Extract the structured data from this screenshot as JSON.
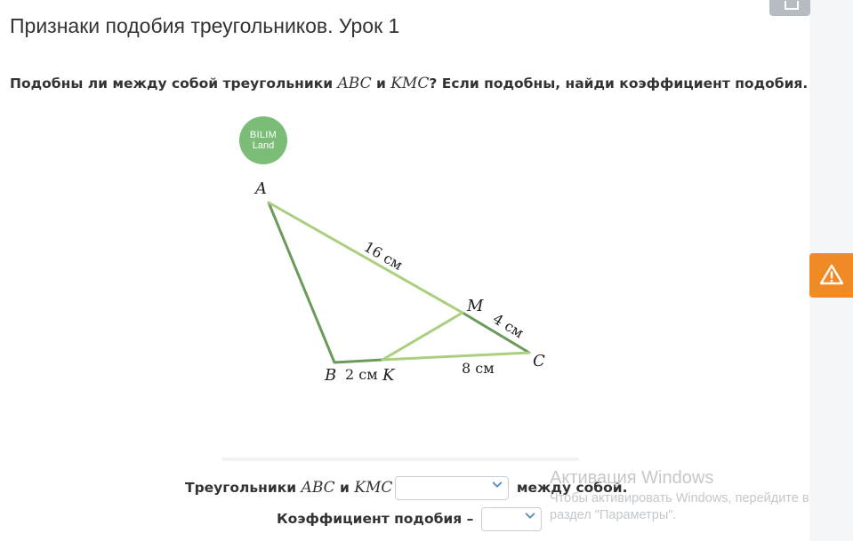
{
  "lesson": {
    "title": "Признаки подобия треугольников. Урок 1"
  },
  "question": {
    "part1": "Подобны ли между собой треугольники ",
    "tri1": "ABC",
    "and": " и ",
    "tri2": "KMC",
    "part2": "? Если подобны, найди коэффициент подобия."
  },
  "logo": {
    "line1": "BILIM",
    "line2": "Land"
  },
  "figure": {
    "vertices": [
      "A",
      "B",
      "C",
      "M",
      "K"
    ],
    "segment_labels": {
      "am": "16 см",
      "mc": "4 см",
      "bk": "2 см",
      "kc": "8 см"
    },
    "colors": {
      "light": "#a9cf7f",
      "dark": "#6b9a5a"
    }
  },
  "answers": {
    "row1_prefix": "Треугольники ",
    "row1_tri1": "ABC",
    "row1_and": " и ",
    "row1_tri2": "KMC",
    "row1_suffix": " между собой.",
    "row1_select_value": "",
    "row2_label": "Коэффициент подобия – ",
    "row2_select_value": ""
  },
  "watermark": {
    "title": "Активация Windows",
    "subtitle": "Чтобы активировать Windows, перейдите в раздел \"Параметры\"."
  },
  "icons": {
    "corner": "expand-icon",
    "warning": "warning-icon",
    "dropdown": "chevron-down-icon"
  },
  "colors": {
    "accent_warning": "#f08a24",
    "logo_green": "#7bbd76",
    "chevron_blue": "#5a8fc4"
  }
}
